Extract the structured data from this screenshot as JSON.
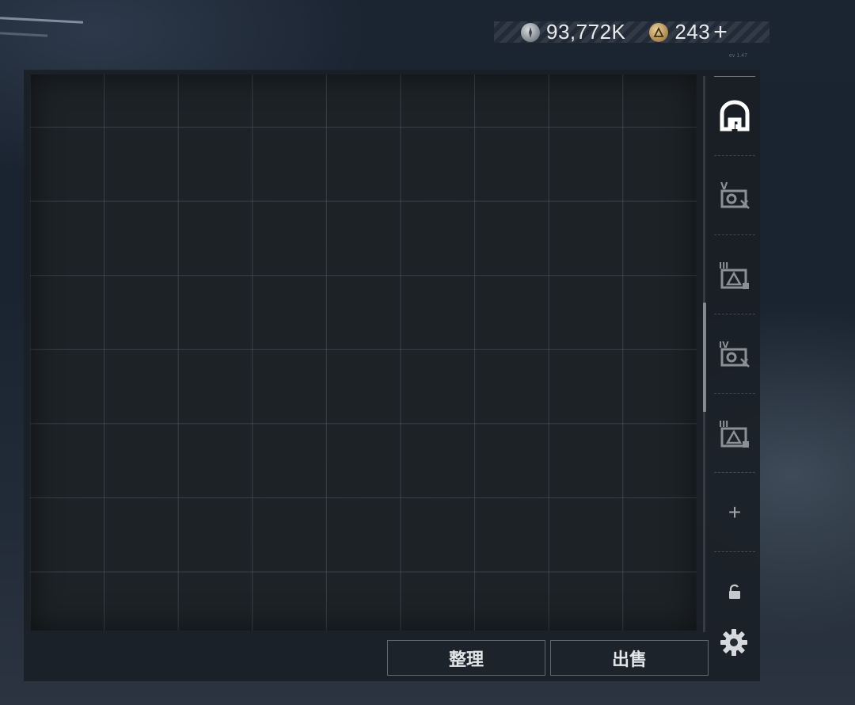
{
  "currency": {
    "silver": {
      "icon": "silver-coin-icon",
      "value": "93,772K"
    },
    "gold": {
      "icon": "gold-coin-icon",
      "value": "243"
    },
    "add_label": "+"
  },
  "version": "ev 1.47",
  "inventory": {
    "columns": 9,
    "rows_visible": 8,
    "scroll_position": 0.4
  },
  "sidebar": {
    "tabs": [
      {
        "name": "stash",
        "icon": "stash-icon",
        "active": true
      },
      {
        "name": "container-v",
        "icon": "container-v-icon"
      },
      {
        "name": "container-iii-a",
        "icon": "container-iii-icon"
      },
      {
        "name": "container-iv",
        "icon": "container-iv-icon"
      },
      {
        "name": "container-iii-b",
        "icon": "container-iii-icon"
      }
    ],
    "add_label": "+"
  },
  "actions": {
    "sort_label": "整理",
    "sell_label": "出售"
  },
  "colors": {
    "panel": "#1a2026",
    "text": "#e3e6e9",
    "active_icon": "#ffffff",
    "inactive_icon": "#8a9096"
  }
}
